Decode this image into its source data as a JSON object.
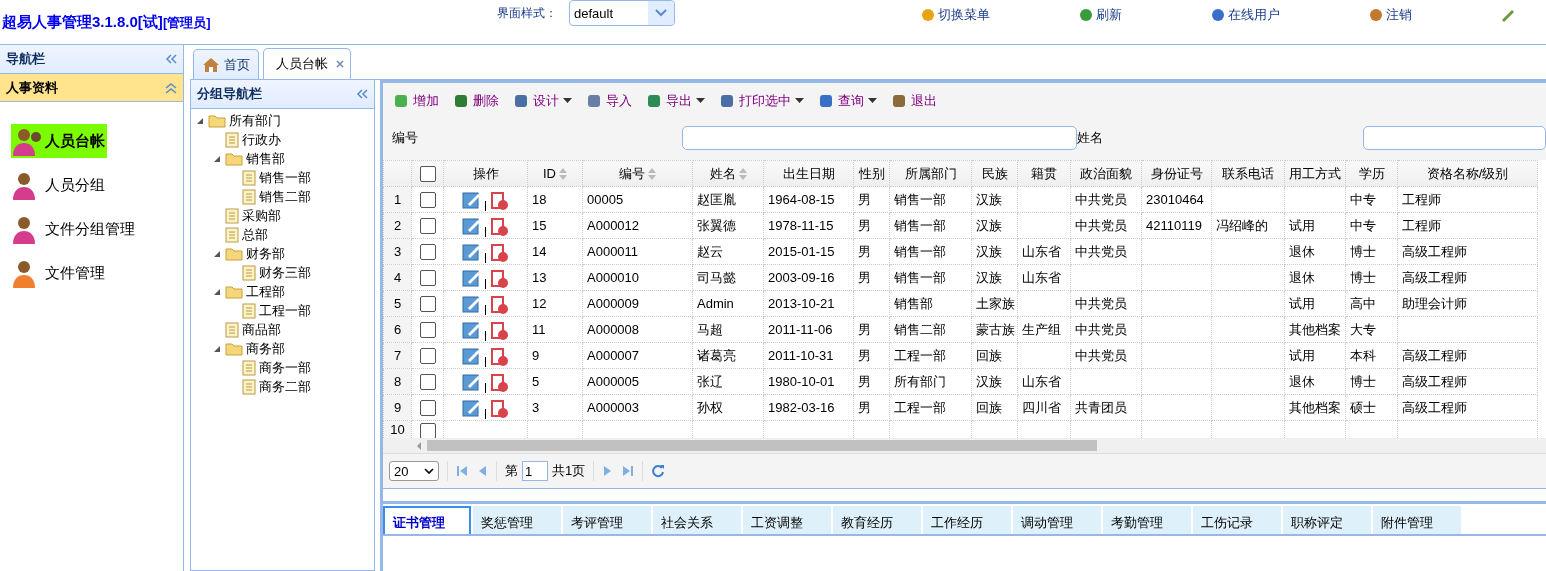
{
  "header": {
    "title": "超易人事管理3.1.8.0[试]",
    "role": "[管理员]",
    "style_label": "界面样式：",
    "style_value": "default",
    "links": [
      "切换菜单",
      "刷新",
      "在线用户",
      "注销"
    ]
  },
  "nav": {
    "title": "导航栏",
    "section": "人事资料",
    "items": [
      {
        "label": "人员台帐",
        "selected": true
      },
      {
        "label": "人员分组",
        "selected": false
      },
      {
        "label": "文件分组管理",
        "selected": false
      },
      {
        "label": "文件管理",
        "selected": false
      }
    ]
  },
  "tabs": [
    {
      "label": "首页",
      "selected": false,
      "closable": false
    },
    {
      "label": "人员台帐",
      "selected": true,
      "closable": true
    }
  ],
  "group_nav": {
    "title": "分组导航栏",
    "tree": [
      {
        "label": "所有部门",
        "expanded": true,
        "children": [
          {
            "label": "行政办"
          },
          {
            "label": "销售部",
            "expanded": true,
            "children": [
              {
                "label": "销售一部"
              },
              {
                "label": "销售二部"
              }
            ]
          },
          {
            "label": "采购部"
          },
          {
            "label": "总部"
          },
          {
            "label": "财务部",
            "expanded": true,
            "children": [
              {
                "label": "财务三部"
              }
            ]
          },
          {
            "label": "工程部",
            "expanded": true,
            "children": [
              {
                "label": "工程一部"
              }
            ]
          },
          {
            "label": "商品部"
          },
          {
            "label": "商务部",
            "expanded": true,
            "children": [
              {
                "label": "商务一部"
              },
              {
                "label": "商务二部"
              }
            ]
          }
        ]
      }
    ]
  },
  "toolbar": [
    {
      "label": "增加",
      "menu": false
    },
    {
      "label": "删除",
      "menu": false
    },
    {
      "label": "设计",
      "menu": true
    },
    {
      "label": "导入",
      "menu": false
    },
    {
      "label": "导出",
      "menu": true
    },
    {
      "label": "打印选中",
      "menu": true
    },
    {
      "label": "查询",
      "menu": true
    },
    {
      "label": "退出",
      "menu": false
    }
  ],
  "search": [
    {
      "label": "编号"
    },
    {
      "label": "姓名"
    }
  ],
  "table": {
    "header_checked": false,
    "action_column": "操作",
    "columns": [
      {
        "label": "ID",
        "sortable": true
      },
      {
        "label": "编号",
        "sortable": true
      },
      {
        "label": "姓名",
        "sortable": true
      },
      {
        "label": "出生日期",
        "sortable": false
      },
      {
        "label": "性别",
        "sortable": false
      },
      {
        "label": "所属部门",
        "sortable": false
      },
      {
        "label": "民族",
        "sortable": false
      },
      {
        "label": "籍贯",
        "sortable": false
      },
      {
        "label": "政治面貌",
        "sortable": false
      },
      {
        "label": "身份证号",
        "sortable": false
      },
      {
        "label": "联系电话",
        "sortable": false
      },
      {
        "label": "用工方式",
        "sortable": false
      },
      {
        "label": "学历",
        "sortable": false
      },
      {
        "label": "资格名称/级别",
        "sortable": false
      }
    ],
    "rows": [
      {
        "index": "1",
        "checked": false,
        "cells": [
          "18",
          "00005",
          "赵匡胤",
          "1964-08-15",
          "男",
          "销售一部",
          "汉族",
          null,
          "中共党员",
          "23010464",
          null,
          null,
          "中专",
          "工程师"
        ]
      },
      {
        "index": "2",
        "checked": false,
        "cells": [
          "15",
          "A000012",
          "张翼德",
          "1978-11-15",
          "男",
          "销售一部",
          "汉族",
          null,
          "中共党员",
          "42110119",
          "冯绍峰的",
          "试用",
          "中专",
          "工程师"
        ]
      },
      {
        "index": "3",
        "checked": false,
        "cells": [
          "14",
          "A000011",
          "赵云",
          "2015-01-15",
          "男",
          "销售一部",
          "汉族",
          "山东省",
          "中共党员",
          null,
          null,
          "退休",
          "博士",
          "高级工程师"
        ]
      },
      {
        "index": "4",
        "checked": false,
        "cells": [
          "13",
          "A000010",
          "司马懿",
          "2003-09-16",
          "男",
          "销售一部",
          "汉族",
          "山东省",
          null,
          null,
          null,
          "退休",
          "博士",
          "高级工程师"
        ]
      },
      {
        "index": "5",
        "checked": false,
        "cells": [
          "12",
          "A000009",
          "Admin",
          "2013-10-21",
          null,
          "销售部",
          "土家族",
          null,
          "中共党员",
          null,
          null,
          "试用",
          "高中",
          "助理会计师"
        ]
      },
      {
        "index": "6",
        "checked": false,
        "cells": [
          "11",
          "A000008",
          "马超",
          "2011-11-06",
          "男",
          "销售二部",
          "蒙古族",
          "生产组",
          "中共党员",
          null,
          null,
          "其他档案",
          "大专",
          null
        ]
      },
      {
        "index": "7",
        "checked": false,
        "cells": [
          "9",
          "A000007",
          "诸葛亮",
          "2011-10-31",
          "男",
          "工程一部",
          "回族",
          null,
          "中共党员",
          null,
          null,
          "试用",
          "本科",
          "高级工程师"
        ]
      },
      {
        "index": "8",
        "checked": false,
        "cells": [
          "5",
          "A000005",
          "张辽",
          "1980-10-01",
          "男",
          "所有部门",
          "汉族",
          "山东省",
          null,
          null,
          null,
          "退休",
          "博士",
          "高级工程师"
        ]
      },
      {
        "index": "9",
        "checked": false,
        "cells": [
          "3",
          "A000003",
          "孙权",
          "1982-03-16",
          "男",
          "工程一部",
          "回族",
          "四川省",
          "共青团员",
          null,
          null,
          "其他档案",
          "硕士",
          "高级工程师"
        ]
      },
      {
        "index": "10",
        "checked": false,
        "cells": []
      }
    ]
  },
  "pager": {
    "page_size": "20",
    "page_prefix": "第",
    "page": "1",
    "total": "共1页"
  },
  "detail_tabs": [
    {
      "label": "证书管理",
      "selected": true
    },
    {
      "label": "奖惩管理",
      "selected": false
    },
    {
      "label": "考评管理",
      "selected": false
    },
    {
      "label": "社会关系",
      "selected": false
    },
    {
      "label": "工资调整",
      "selected": false
    },
    {
      "label": "教育经历",
      "selected": false
    },
    {
      "label": "工作经历",
      "selected": false
    },
    {
      "label": "调动管理",
      "selected": false
    },
    {
      "label": "考勤管理",
      "selected": false
    },
    {
      "label": "工伤记录",
      "selected": false
    },
    {
      "label": "职称评定",
      "selected": false
    },
    {
      "label": "附件管理",
      "selected": false
    }
  ]
}
